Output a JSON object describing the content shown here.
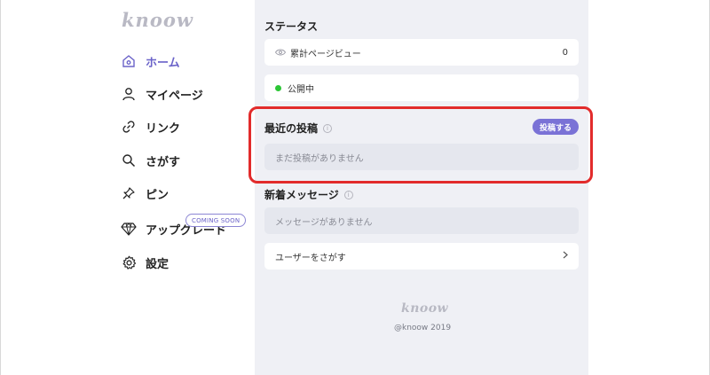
{
  "brand": {
    "logo": "knoow"
  },
  "sidebar": {
    "items": [
      {
        "label": "ホーム",
        "icon": "home-icon",
        "active": true
      },
      {
        "label": "マイページ",
        "icon": "user-icon"
      },
      {
        "label": "リンク",
        "icon": "link-icon"
      },
      {
        "label": "さがす",
        "icon": "search-icon"
      },
      {
        "label": "ピン",
        "icon": "pin-icon"
      },
      {
        "label": "アップグレード",
        "icon": "diamond-icon",
        "badge": "COMING SOON"
      },
      {
        "label": "設定",
        "icon": "gear-icon"
      }
    ]
  },
  "main": {
    "status": {
      "title": "ステータス",
      "pageviews_label": "累計ページビュー",
      "pageviews_value": "0",
      "visibility_label": "公開中"
    },
    "recent_posts": {
      "title": "最近の投稿",
      "button_label": "投稿する",
      "empty_text": "まだ投稿がありません"
    },
    "messages": {
      "title": "新着メッセージ",
      "empty_text": "メッセージがありません"
    },
    "find_users": {
      "label": "ユーザーをさがす"
    },
    "footer": {
      "logo": "knoow",
      "copyright": "@knoow 2019"
    }
  },
  "colors": {
    "accent": "#6b63c9",
    "button": "#7a72d6",
    "highlight": "#e22b2b",
    "status_green": "#2cc636",
    "main_bg": "#eff0f5"
  }
}
